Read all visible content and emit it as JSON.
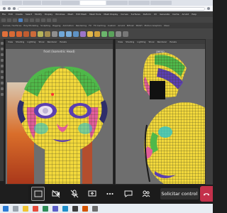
{
  "browser": {
    "tabs": [
      "",
      "",
      "",
      "",
      "",
      "",
      "",
      ""
    ],
    "address": ""
  },
  "maya": {
    "menu": [
      "File",
      "Edit",
      "Create",
      "Select",
      "Modify",
      "Display",
      "Windows",
      "Mesh",
      "Edit Mesh",
      "Mesh Tools",
      "Mesh Display",
      "Curves",
      "Surfaces",
      "Deform",
      "UV",
      "Generate",
      "Cache",
      "Arnold",
      "Help"
    ],
    "shelf_tabs": [
      "Curves / Surfaces",
      "Poly Modeling",
      "Sculpting",
      "Rigging",
      "Animation",
      "Rendering",
      "FX",
      "FX Caching",
      "Custom",
      "Arnold",
      "Bifrost",
      "MASH",
      "Motion Graphics",
      "XGen"
    ],
    "left_view": {
      "menu": [
        "View",
        "Shading",
        "Lighting",
        "Show",
        "Renderer",
        "Panels"
      ],
      "title": "front (Isometric Head)"
    },
    "right_view": {
      "menu": [
        "View",
        "Shading",
        "Lighting",
        "Show",
        "Renderer",
        "Panels"
      ],
      "title": "persp"
    }
  },
  "call": {
    "request_control_label": "Solicitar control"
  },
  "colors": {
    "wire_yellow": "#f2d83c",
    "wire_green": "#4fb84a",
    "wire_pink": "#e15d9a",
    "wire_purple": "#5b3fb0",
    "wire_cyan": "#2ec4c9",
    "hangup_red": "#c4314b"
  }
}
